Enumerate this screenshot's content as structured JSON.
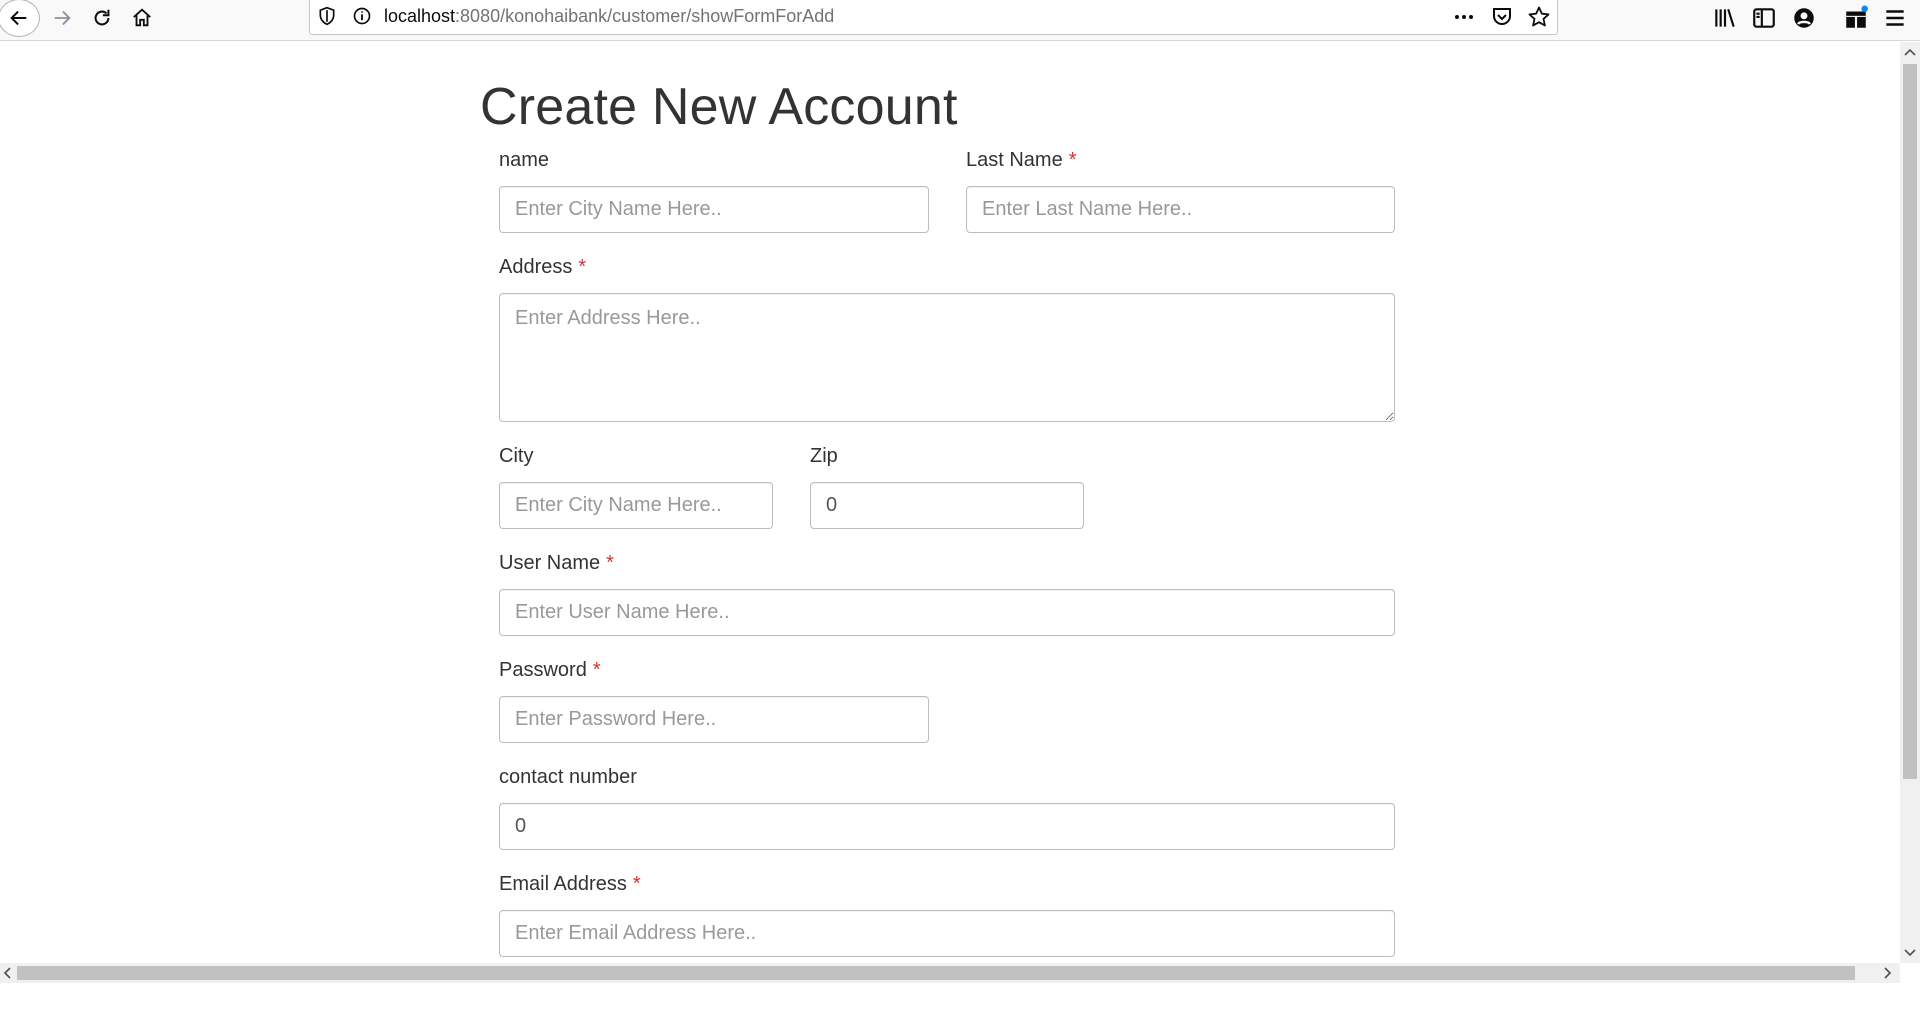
{
  "browser": {
    "url_host": "localhost",
    "url_rest": ":8080/konohaibank/customer/showFormForAdd"
  },
  "form": {
    "title": "Create New Account",
    "required_mark": "*",
    "name": {
      "label": "name",
      "placeholder": "Enter City Name Here.."
    },
    "last_name": {
      "label": "Last Name",
      "placeholder": "Enter Last Name Here.."
    },
    "address": {
      "label": "Address",
      "placeholder": "Enter Address Here.."
    },
    "city": {
      "label": "City",
      "placeholder": "Enter City Name Here.."
    },
    "zip": {
      "label": "Zip",
      "value": "0"
    },
    "user_name": {
      "label": "User Name",
      "placeholder": "Enter User Name Here.."
    },
    "password": {
      "label": "Password",
      "placeholder": "Enter Password Here.."
    },
    "contact_number": {
      "label": "contact number",
      "value": "0"
    },
    "email": {
      "label": "Email Address",
      "placeholder": "Enter Email Address Here.."
    }
  },
  "scrollbars": {
    "left_arrow": "<",
    "right_arrow": ">",
    "up_arrow": "^",
    "down_arrow": "v"
  },
  "icons": {
    "back": "back-arrow-icon",
    "forward": "forward-arrow-icon",
    "reload": "reload-icon",
    "home": "home-icon",
    "tracking": "shield-icon",
    "site_info": "info-icon",
    "page_actions": "more-icon",
    "pocket": "pocket-icon",
    "bookmark": "star-icon",
    "library": "library-icon",
    "sidebar": "sidebar-icon",
    "account": "account-icon",
    "extension": "extension-icon",
    "menu": "hamburger-menu-icon"
  },
  "colors": {
    "required": "#d9302f",
    "text": "#333333",
    "placeholder": "#999999",
    "input_border": "#bdbdbd"
  }
}
